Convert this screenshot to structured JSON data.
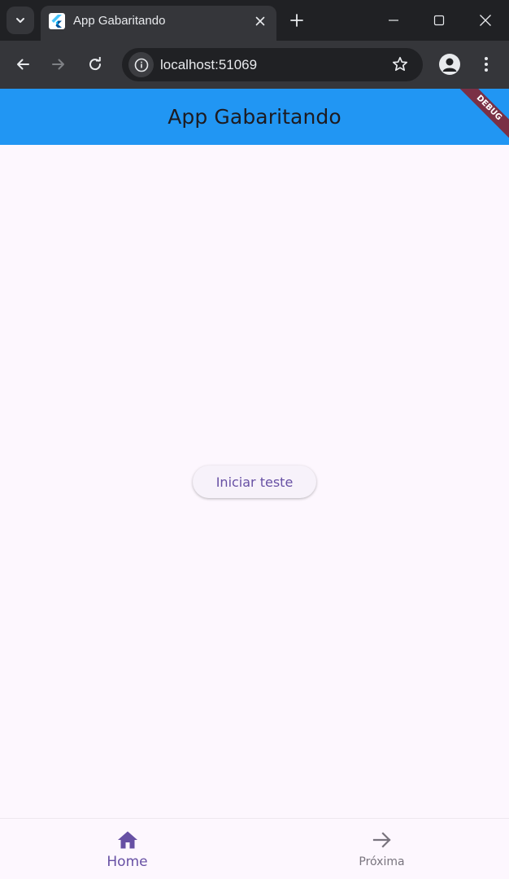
{
  "browser": {
    "tab_title": "App Gabaritando",
    "url": "localhost:51069",
    "icons": {
      "tab_search": "chevron-down-icon",
      "favicon": "flutter-icon",
      "close": "close-icon",
      "new_tab": "plus-icon",
      "back": "arrow-left-icon",
      "forward": "arrow-right-icon",
      "reload": "reload-icon",
      "site_info": "info-icon",
      "bookmark": "star-icon",
      "profile": "person-icon",
      "menu": "more-vertical-icon",
      "minimize": "minimize-icon",
      "maximize": "maximize-icon",
      "window_close": "close-icon"
    }
  },
  "app": {
    "title": "App Gabaritando",
    "debug_banner": "DEBUG",
    "start_button_label": "Iniciar teste",
    "bottom_nav": {
      "items": [
        {
          "label": "Home",
          "icon": "home-icon",
          "selected": true
        },
        {
          "label": "Próxima",
          "icon": "arrow-forward-icon",
          "selected": false
        }
      ]
    },
    "colors": {
      "appbar": "#2196f3",
      "background": "#fdf7fe",
      "primary": "#6750a4",
      "debug_banner": "#7a3045"
    }
  }
}
